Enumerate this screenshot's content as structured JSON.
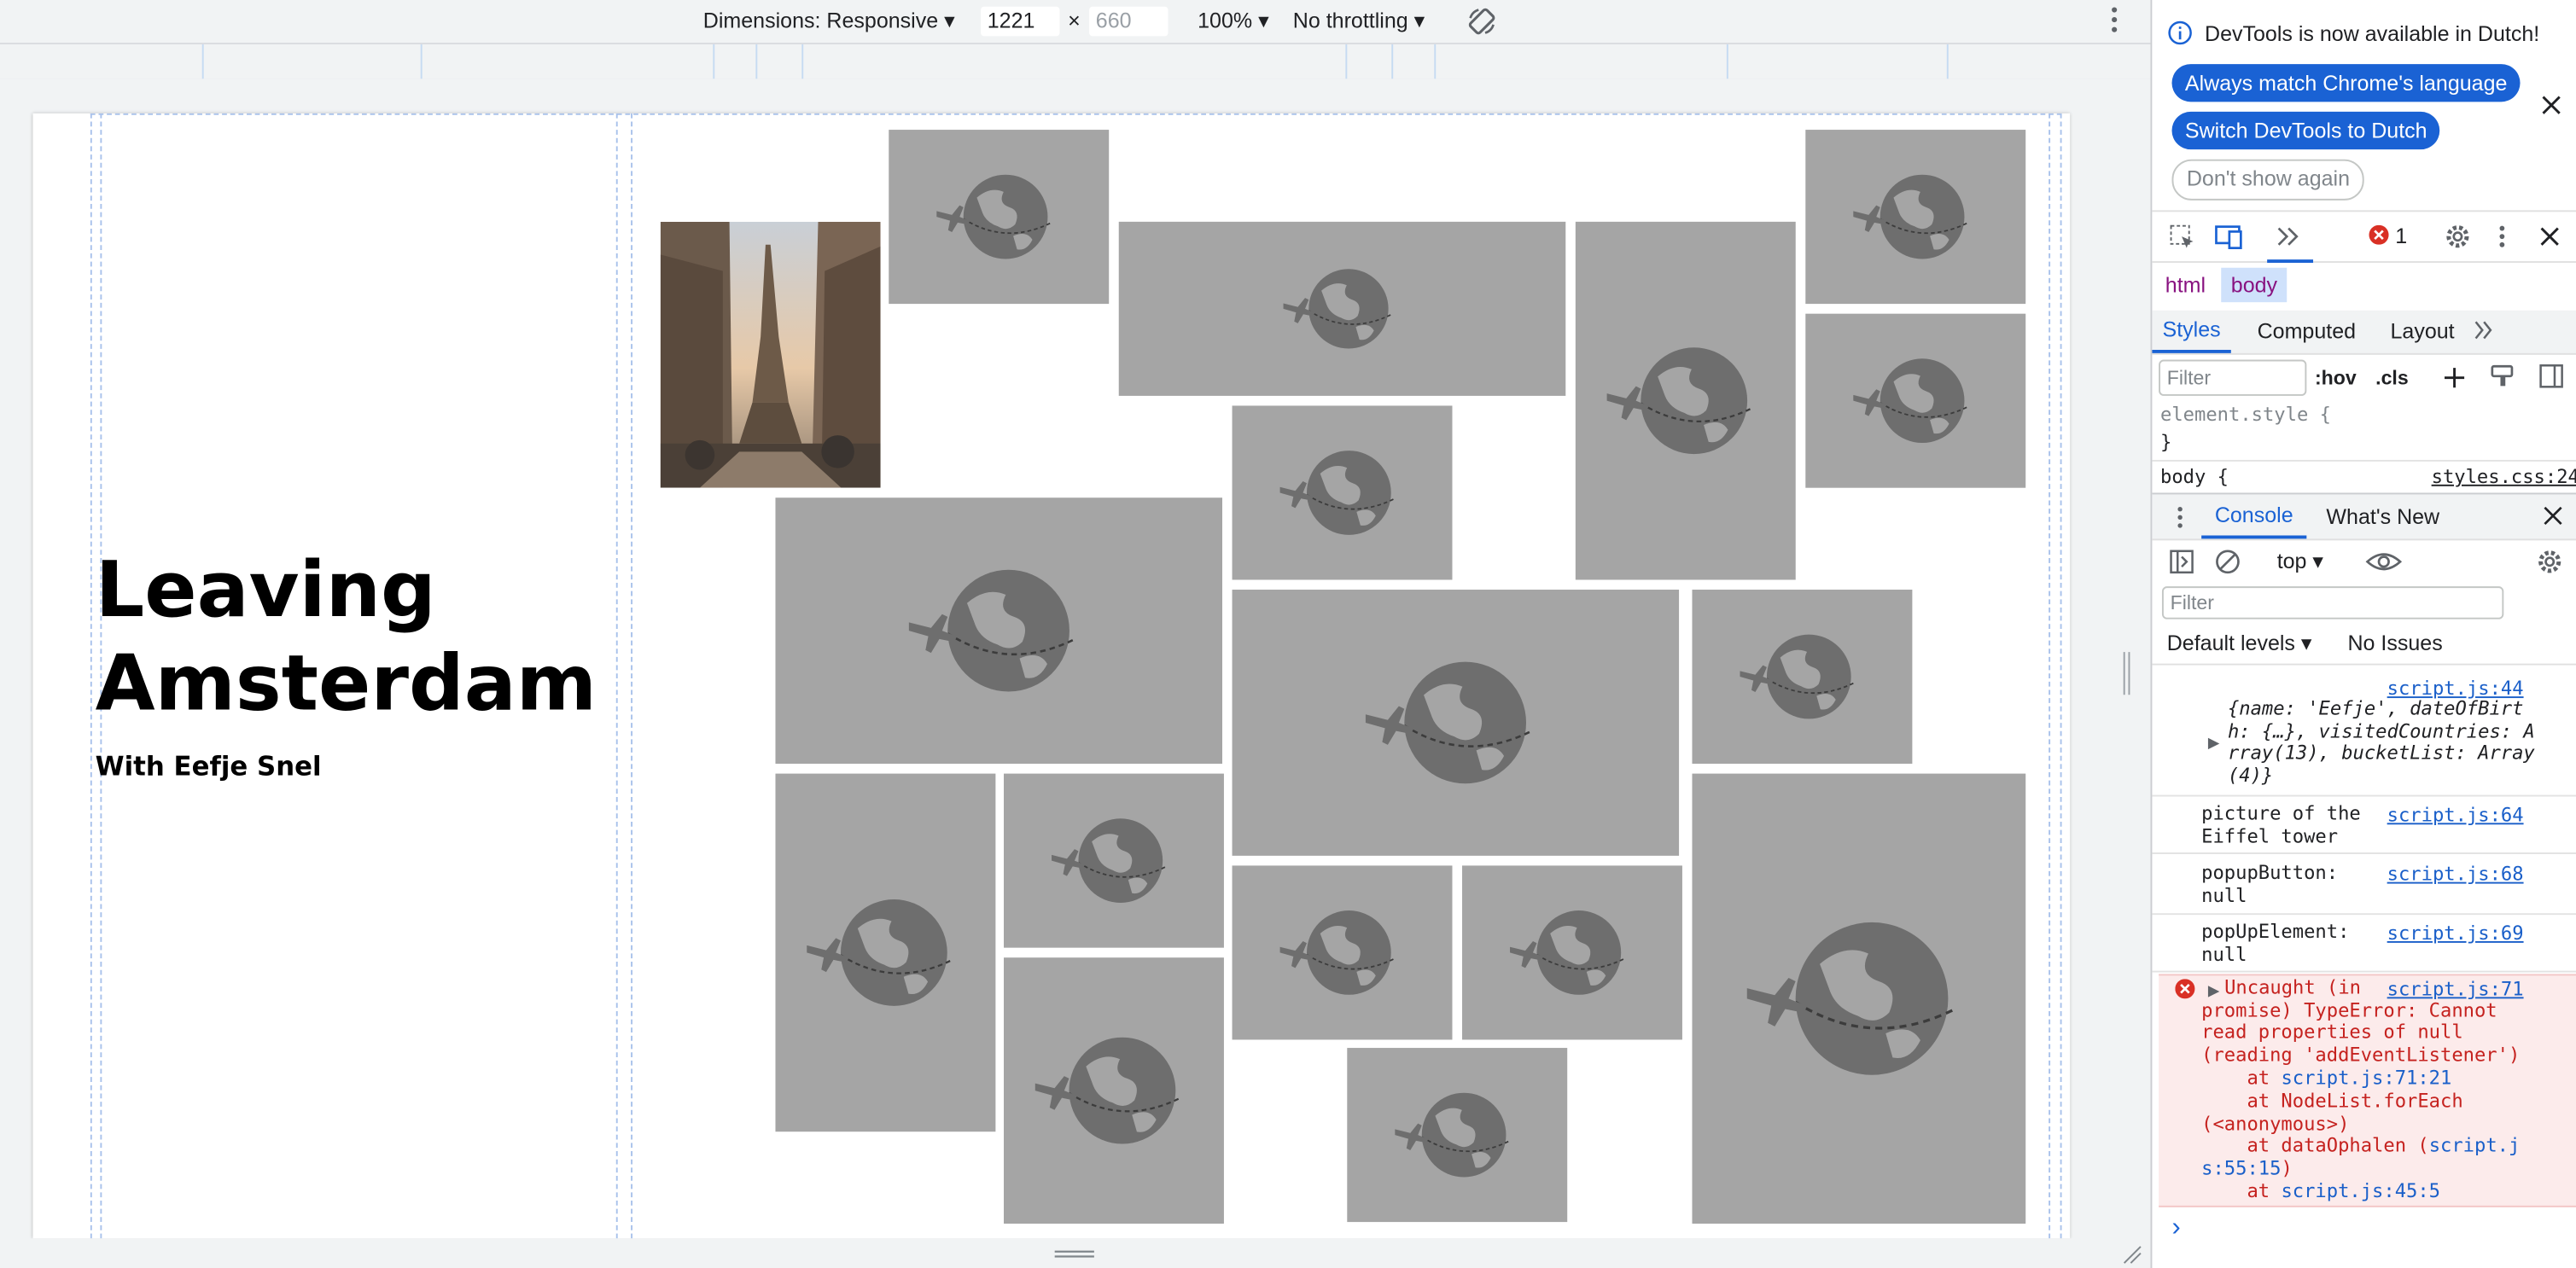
{
  "toolbar": {
    "dimensions_label": "Dimensions: Responsive",
    "width_value": "1221",
    "height_value": "660",
    "times": "×",
    "zoom": "100%",
    "throttling": "No throttling",
    "rotate_icon": "rotate-icon",
    "more_icon": "more-vertical-icon"
  },
  "page": {
    "title": "Leaving Amsterdam",
    "subtitle": "With Eefje Snel",
    "photo_alt": "picture of the Eiffel tower",
    "placeholder_icon": "globe-plane-icon"
  },
  "devtools": {
    "infobar": {
      "message": "DevTools is now available in Dutch!",
      "btn_match": "Always match Chrome's language",
      "btn_switch": "Switch DevTools to Dutch",
      "btn_dont_show": "Don't show again"
    },
    "tabbar": {
      "error_count": "1"
    },
    "breadcrumbs": [
      "html",
      "body"
    ],
    "styles_tabs": [
      "Styles",
      "Computed",
      "Layout"
    ],
    "filter_placeholder": "Filter",
    "hov": ":hov",
    "cls": ".cls",
    "element_style_open": "element.style {",
    "element_style_close": "}",
    "body_rule": "body {",
    "body_source": "styles.css:24",
    "drawer_tabs": [
      "Console",
      "What's New"
    ],
    "console": {
      "context": "top",
      "filter_placeholder": "Filter",
      "levels": "Default levels",
      "issues": "No Issues",
      "messages": [
        {
          "source": "script.js:44",
          "text": "{name: 'Eefje', dateOfBirt\nh: {…}, visitedCountries: A\nrray(13), bucketList: Array\n(4)}"
        },
        {
          "source": "script.js:64",
          "text": "picture of the\nEiffel tower"
        },
        {
          "source": "script.js:68",
          "text": "popupButton:\nnull"
        },
        {
          "source": "script.js:69",
          "text": "popUpElement:\nnull"
        }
      ],
      "error": {
        "source": "script.js:71",
        "text": "Uncaught (in\npromise) TypeError: Cannot\nread properties of null\n(reading 'addEventListener')",
        "stack_1_prefix": "    at ",
        "stack_1_link": "script.js:71:21",
        "stack_2": "    at NodeList.forEach\n(<anonymous>)",
        "stack_3_prefix": "    at dataOphalen (",
        "stack_3_link": "script.j\ns:55:15",
        "stack_3_suffix": ")",
        "stack_4_prefix": "    at ",
        "stack_4_link": "script.js:45:5"
      },
      "prompt": "›"
    }
  },
  "colors": {
    "placeholder_bg": "#a5a5a5",
    "globe": "#6e6e6e",
    "accent": "#1a62d4",
    "error_bg": "#fcebeb"
  }
}
